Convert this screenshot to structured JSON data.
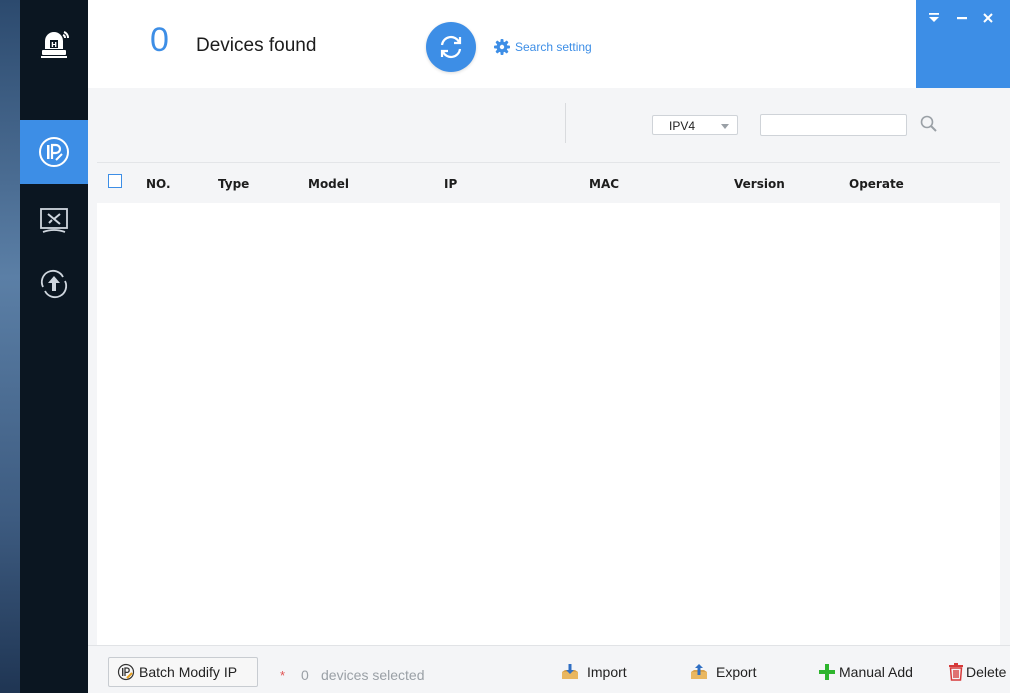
{
  "header": {
    "device_count": "0",
    "devices_found_label": "Devices found",
    "search_setting_label": "Search setting"
  },
  "window_controls": {
    "menu_icon": "dropdown-menu-icon",
    "minimize_icon": "minimize-icon",
    "close_icon": "close-icon"
  },
  "sidebar": {
    "items": [
      {
        "name": "ip-modify",
        "icon": "ip-icon",
        "active": true
      },
      {
        "name": "system-settings",
        "icon": "tools-icon",
        "active": false
      },
      {
        "name": "upgrade",
        "icon": "upgrade-icon",
        "active": false
      }
    ]
  },
  "filter": {
    "ip_version": "IPV4",
    "search_value": "",
    "search_placeholder": ""
  },
  "table": {
    "columns": [
      "NO.",
      "Type",
      "Model",
      "IP",
      "MAC",
      "Version",
      "Operate"
    ],
    "rows": []
  },
  "footer": {
    "batch_modify_label": "Batch Modify IP",
    "required_star": "*",
    "selected_count": "0",
    "selected_label": "devices selected",
    "import_label": "Import",
    "export_label": "Export",
    "manual_add_label": "Manual Add",
    "delete_label": "Delete"
  },
  "colors": {
    "accent": "#3d8ee6",
    "sidebar_bg": "#0b1621",
    "add_green": "#2db52d",
    "delete_red": "#d63a3a"
  }
}
